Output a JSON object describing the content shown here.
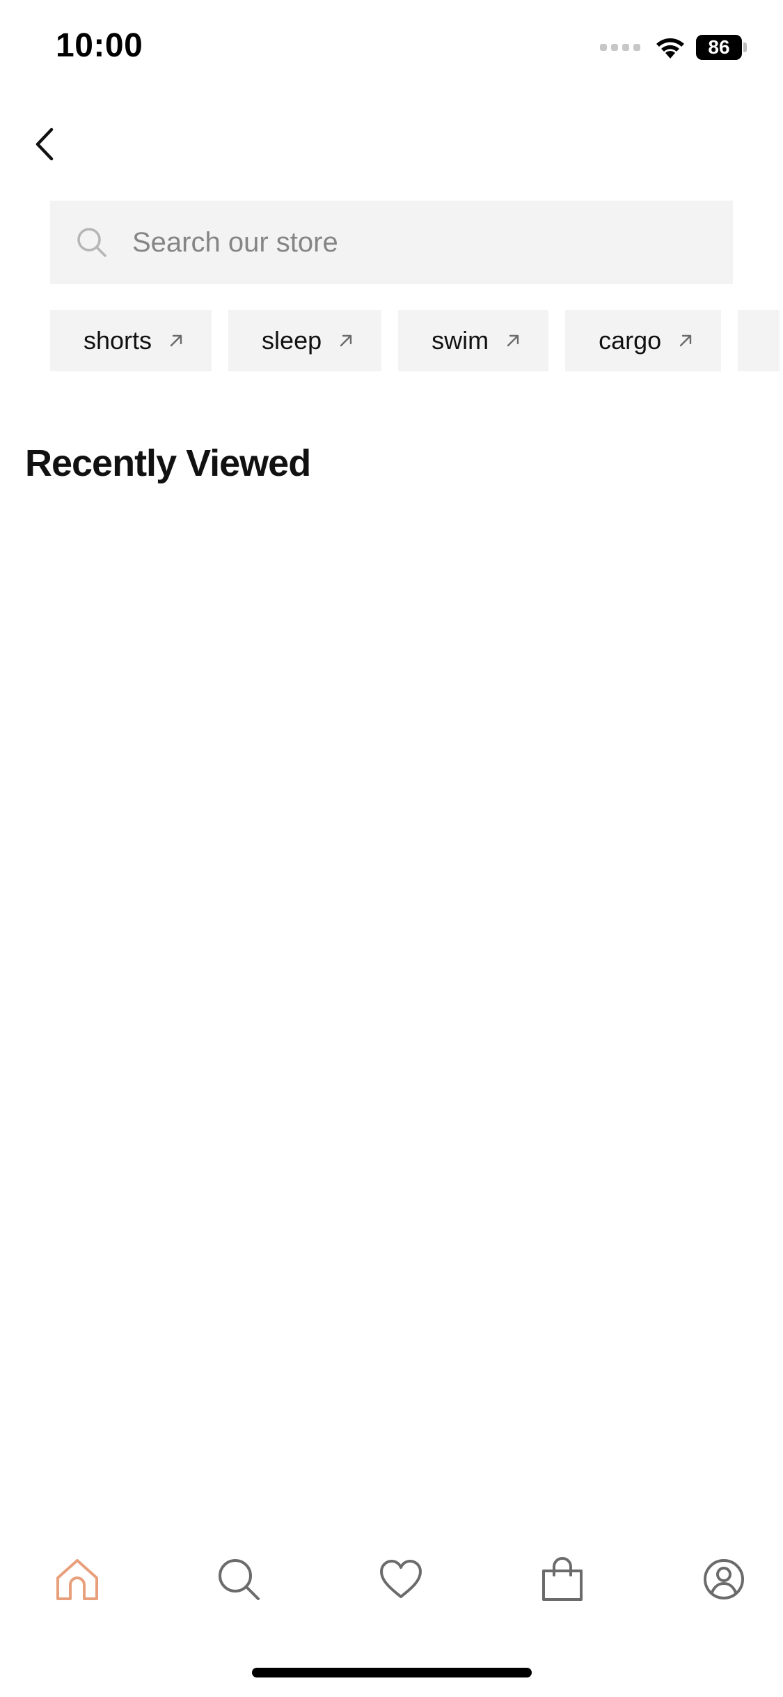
{
  "status_bar": {
    "time": "10:00",
    "battery_level": "86",
    "icons": [
      "cellular-signal-icon",
      "wifi-icon",
      "battery-icon"
    ]
  },
  "nav": {
    "back_icon": "chevron-left-icon"
  },
  "search": {
    "placeholder": "Search our store",
    "value": "",
    "icon": "search-icon"
  },
  "chips": [
    {
      "label": "shorts",
      "icon": "arrow-up-right-icon"
    },
    {
      "label": "sleep",
      "icon": "arrow-up-right-icon"
    },
    {
      "label": "swim",
      "icon": "arrow-up-right-icon"
    },
    {
      "label": "cargo",
      "icon": "arrow-up-right-icon"
    }
  ],
  "recently_viewed": {
    "title": "Recently Viewed"
  },
  "tab_bar": {
    "active": "home",
    "accent_color": "#e8a07c",
    "inactive_color": "#6b6b6b",
    "tabs": [
      {
        "id": "home",
        "icon": "home-icon"
      },
      {
        "id": "search",
        "icon": "search-icon"
      },
      {
        "id": "wishlist",
        "icon": "heart-icon"
      },
      {
        "id": "bag",
        "icon": "shopping-bag-icon"
      },
      {
        "id": "account",
        "icon": "account-icon"
      }
    ]
  }
}
